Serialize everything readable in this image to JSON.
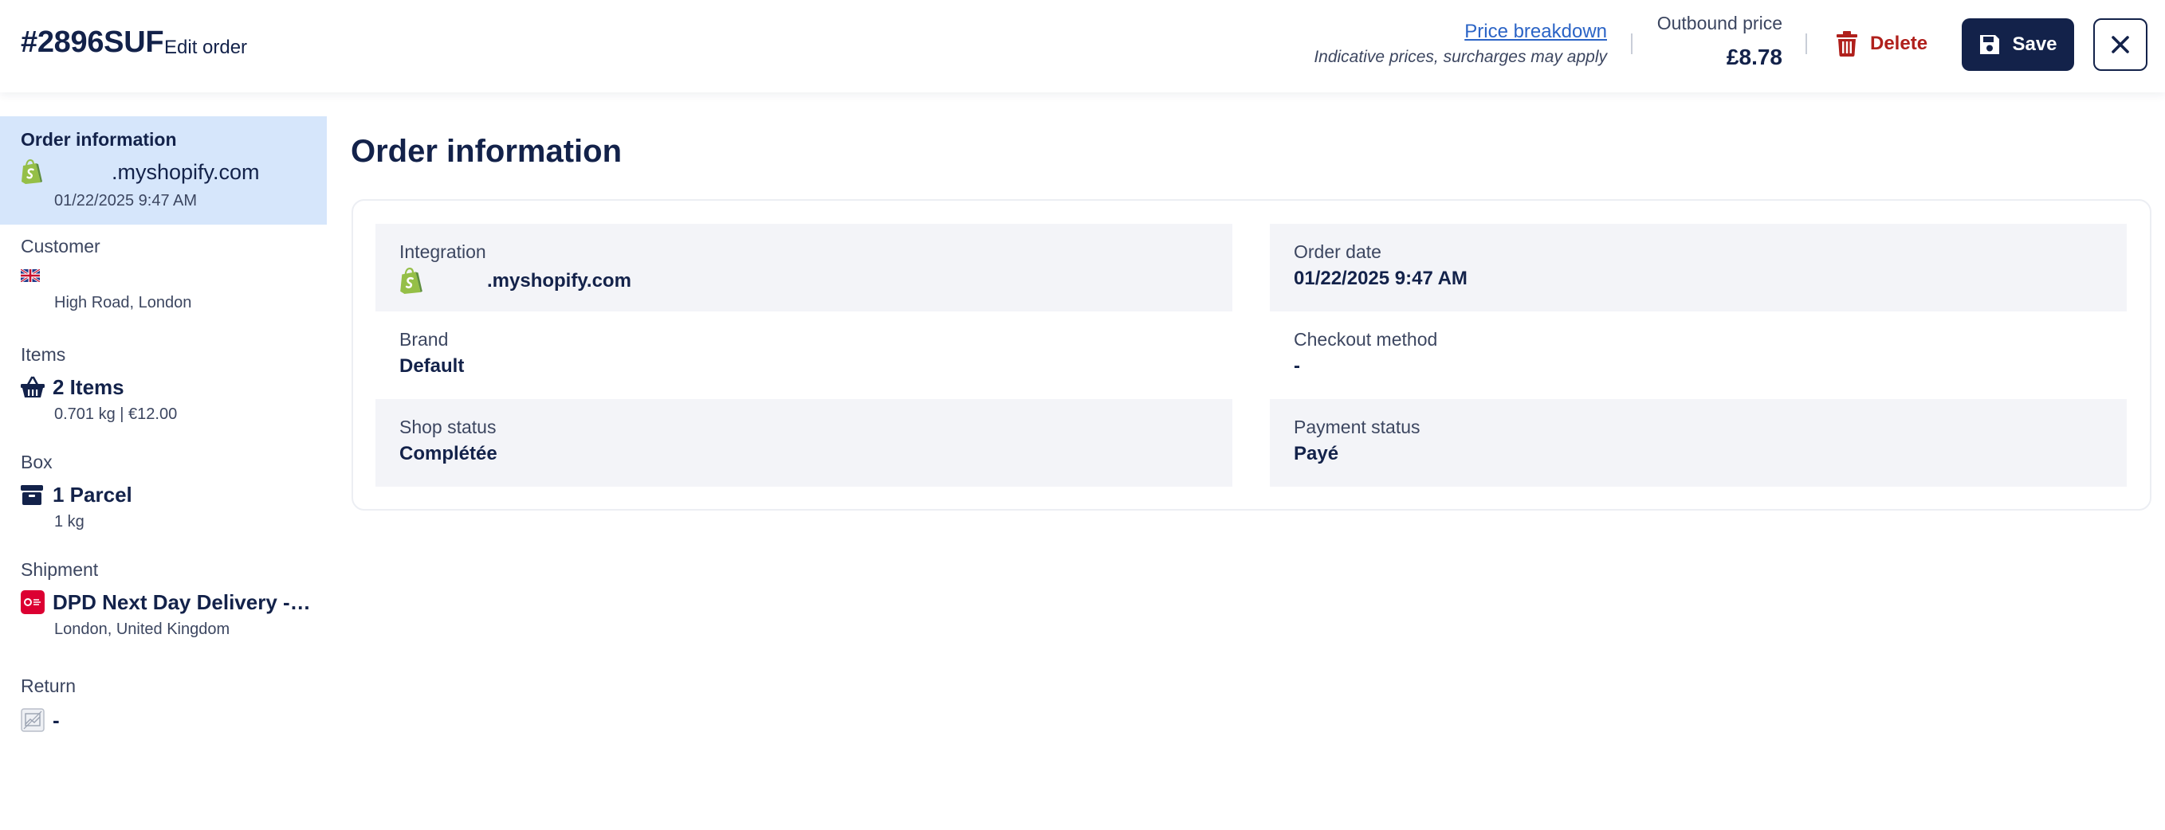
{
  "header": {
    "order_id": "#2896SUF",
    "edit_label": "Edit order",
    "price_breakdown_link": "Price breakdown",
    "price_note": "Indicative prices, surcharges may apply",
    "outbound_label": "Outbound price",
    "outbound_value": "£8.78",
    "delete_label": "Delete",
    "save_label": "Save"
  },
  "sidebar": {
    "order_info": {
      "title": "Order information",
      "store": ".myshopify.com",
      "date": "01/22/2025 9:47 AM"
    },
    "customer": {
      "title": "Customer",
      "address": "High Road, London"
    },
    "items": {
      "title": "Items",
      "main": "2 Items",
      "sub": "0.701 kg | €12.00"
    },
    "box": {
      "title": "Box",
      "main": "1 Parcel",
      "sub": "1 kg"
    },
    "shipment": {
      "title": "Shipment",
      "main": "DPD Next Day Delivery - …",
      "sub": "London, United Kingdom"
    },
    "return": {
      "title": "Return",
      "main": "-"
    }
  },
  "main": {
    "title": "Order information",
    "fields": {
      "integration": {
        "label": "Integration",
        "value": ".myshopify.com"
      },
      "order_date": {
        "label": "Order date",
        "value": "01/22/2025 9:47 AM"
      },
      "brand": {
        "label": "Brand",
        "value": "Default"
      },
      "checkout_method": {
        "label": "Checkout method",
        "value": "-"
      },
      "shop_status": {
        "label": "Shop status",
        "value": "Complétée"
      },
      "payment_status": {
        "label": "Payment status",
        "value": "Payé"
      }
    }
  },
  "icons": {
    "shopify": "shopify-icon",
    "flag": "uk-flag-icon",
    "basket": "basket-icon",
    "box": "box-icon",
    "dpd": "dpd-carrier-icon",
    "return": "image-placeholder-icon",
    "trash": "trash-icon",
    "save": "floppy-disk-icon",
    "close": "close-icon"
  },
  "colors": {
    "primary": "#13224a",
    "danger": "#b0201c",
    "link": "#2b64c6",
    "active_bg": "#d6e6fb",
    "field_bg": "#f3f4f8",
    "shopify_green": "#95bf47",
    "dpd_red": "#dc0032"
  }
}
